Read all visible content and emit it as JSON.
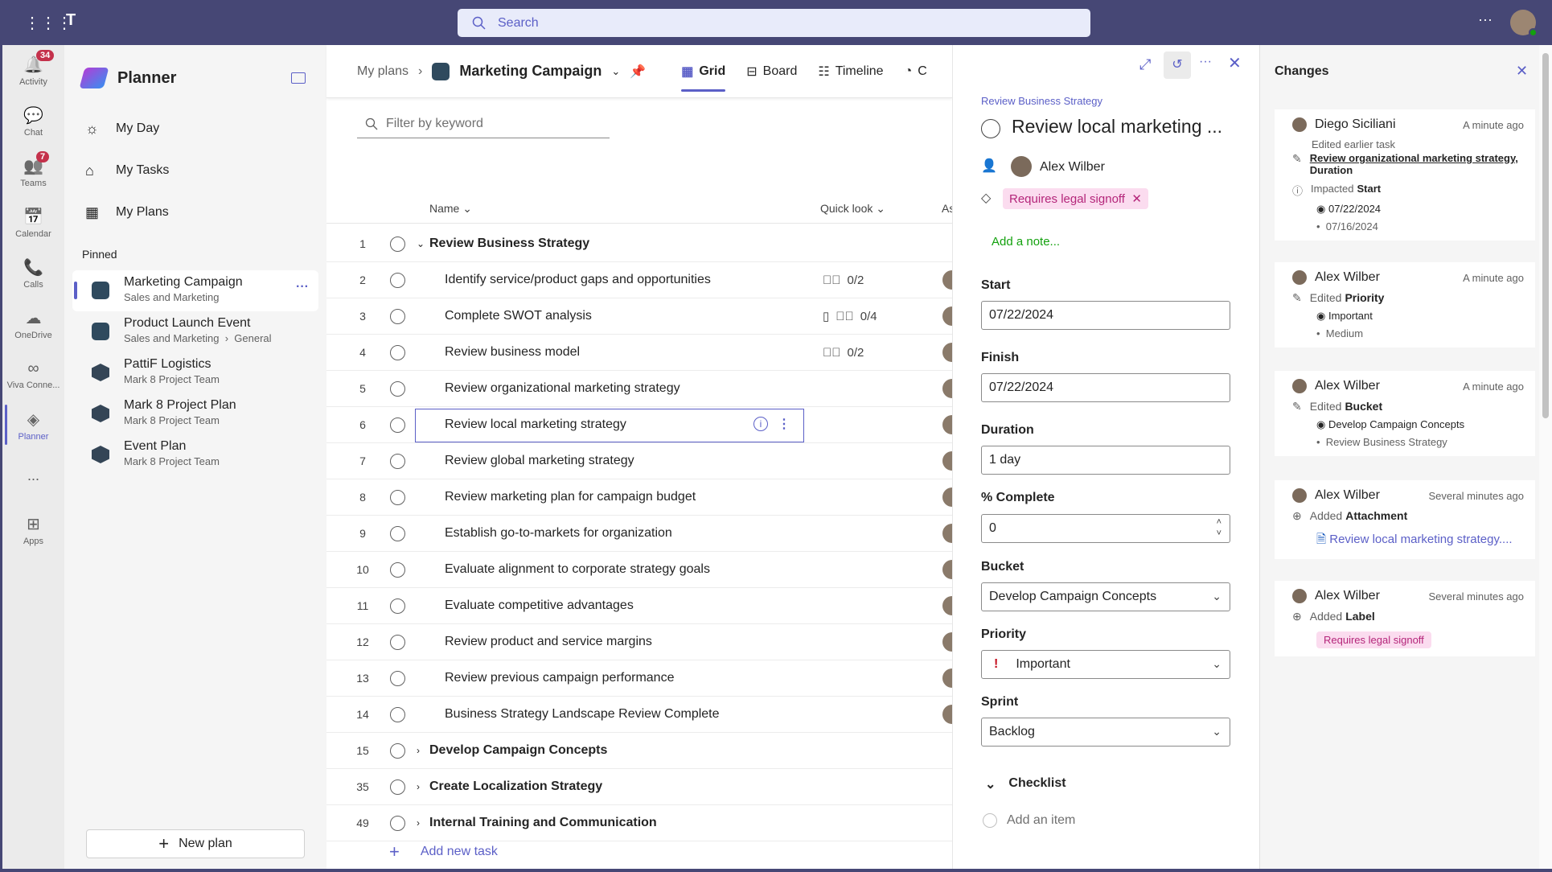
{
  "topbar": {
    "search_placeholder": "Search",
    "more_icon": "ellipsis-icon",
    "avatar_status": "available"
  },
  "rail": [
    {
      "label": "Activity",
      "icon": "bell-icon",
      "badge": "34"
    },
    {
      "label": "Chat",
      "icon": "chat-icon"
    },
    {
      "label": "Teams",
      "icon": "teams-icon",
      "badge": "7"
    },
    {
      "label": "Calendar",
      "icon": "calendar-icon"
    },
    {
      "label": "Calls",
      "icon": "phone-icon"
    },
    {
      "label": "OneDrive",
      "icon": "cloud-icon"
    },
    {
      "label": "Viva Conne...",
      "icon": "viva-icon"
    },
    {
      "label": "Planner",
      "icon": "planner-icon",
      "active": true
    },
    {
      "label": "...",
      "icon": "more-icon"
    },
    {
      "label": "Apps",
      "icon": "apps-icon"
    }
  ],
  "sidebar": {
    "title": "Planner",
    "nav": [
      {
        "label": "My Day",
        "icon": "sun-icon"
      },
      {
        "label": "My Tasks",
        "icon": "tasks-icon"
      },
      {
        "label": "My Plans",
        "icon": "grid-icon"
      }
    ],
    "pinned_label": "Pinned",
    "pinned": [
      {
        "title": "Marketing Campaign",
        "sub": "Sales and Marketing",
        "selected": true
      },
      {
        "title": "Product Launch Event",
        "sub": "Sales and Marketing",
        "sub2": "General"
      },
      {
        "title": "PattiF Logistics",
        "sub": "Mark 8 Project Team"
      },
      {
        "title": "Mark 8 Project Plan",
        "sub": "Mark 8 Project Team"
      },
      {
        "title": "Event Plan",
        "sub": "Mark 8 Project Team"
      }
    ],
    "new_plan": "New plan"
  },
  "main": {
    "breadcrumb_root": "My plans",
    "plan_title": "Marketing Campaign",
    "tabs": [
      {
        "label": "Grid",
        "active": true
      },
      {
        "label": "Board"
      },
      {
        "label": "Timeline"
      },
      {
        "label": "C"
      }
    ],
    "filter_placeholder": "Filter by keyword",
    "columns": {
      "name": "Name",
      "quick_look": "Quick look",
      "assigned": "As"
    },
    "rows": [
      {
        "n": "1",
        "title": "Review Business Strategy",
        "group": true,
        "expanded": true
      },
      {
        "n": "2",
        "title": "Identify service/product gaps and opportunities",
        "checklist": "0/2"
      },
      {
        "n": "3",
        "title": "Complete SWOT analysis",
        "note": true,
        "checklist": "0/4"
      },
      {
        "n": "4",
        "title": "Review business model",
        "checklist": "0/2"
      },
      {
        "n": "5",
        "title": "Review organizational marketing strategy"
      },
      {
        "n": "6",
        "title": "Review local marketing strategy",
        "selected": true
      },
      {
        "n": "7",
        "title": "Review global marketing strategy"
      },
      {
        "n": "8",
        "title": "Review marketing plan for campaign budget"
      },
      {
        "n": "9",
        "title": "Establish go-to-markets for organization"
      },
      {
        "n": "10",
        "title": "Evaluate alignment to corporate strategy goals"
      },
      {
        "n": "11",
        "title": "Evaluate competitive advantages"
      },
      {
        "n": "12",
        "title": "Review product and service margins"
      },
      {
        "n": "13",
        "title": "Review previous campaign performance"
      },
      {
        "n": "14",
        "title": "Business Strategy Landscape Review Complete"
      },
      {
        "n": "15",
        "title": "Develop Campaign Concepts",
        "group": true
      },
      {
        "n": "35",
        "title": "Create Localization Strategy",
        "group": true
      },
      {
        "n": "49",
        "title": "Internal Training and Communication",
        "group": true
      }
    ],
    "add_task": "Add new task"
  },
  "detail": {
    "bucket_link": "Review Business Strategy",
    "title": "Review local marketing ...",
    "assignee": "Alex Wilber",
    "label": "Requires legal signoff",
    "add_note": "Add a note...",
    "start_label": "Start",
    "start": "07/22/2024",
    "finish_label": "Finish",
    "finish": "07/22/2024",
    "duration_label": "Duration",
    "duration": "1 day",
    "complete_label": "% Complete",
    "complete": "0",
    "bucket_label": "Bucket",
    "bucket": "Develop Campaign Concepts",
    "priority_label": "Priority",
    "priority": "Important",
    "sprint_label": "Sprint",
    "sprint": "Backlog",
    "checklist_label": "Checklist",
    "add_item": "Add an item"
  },
  "changes": {
    "title": "Changes",
    "cards": [
      {
        "user": "Diego Siciliani",
        "when": "A minute ago",
        "pre": "Edited earlier task",
        "link": "Review organizational marketing strategy,",
        "field": "Duration",
        "line2pre": "Impacted",
        "line2": "Start",
        "new": "07/22/2024",
        "old": "07/16/2024"
      },
      {
        "user": "Alex Wilber",
        "when": "A minute ago",
        "pre": "Edited",
        "field": "Priority",
        "new": "Important",
        "old": "Medium"
      },
      {
        "user": "Alex Wilber",
        "when": "A minute ago",
        "pre": "Edited",
        "field": "Bucket",
        "new": "Develop Campaign Concepts",
        "old": "Review Business Strategy"
      },
      {
        "user": "Alex Wilber",
        "when": "Several minutes ago",
        "pre": "Added",
        "field": "Attachment",
        "attachment": "Review local marketing strategy...."
      },
      {
        "user": "Alex Wilber",
        "when": "Several minutes ago",
        "pre": "Added",
        "field": "Label",
        "tag": "Requires legal signoff"
      }
    ]
  },
  "colors": {
    "brand": "#5b5fc7",
    "topbar": "#464775",
    "label_bg": "#fbdcef",
    "label_fg": "#b4267a",
    "note_green": "#13a10e",
    "priority_red": "#c50f1f"
  }
}
